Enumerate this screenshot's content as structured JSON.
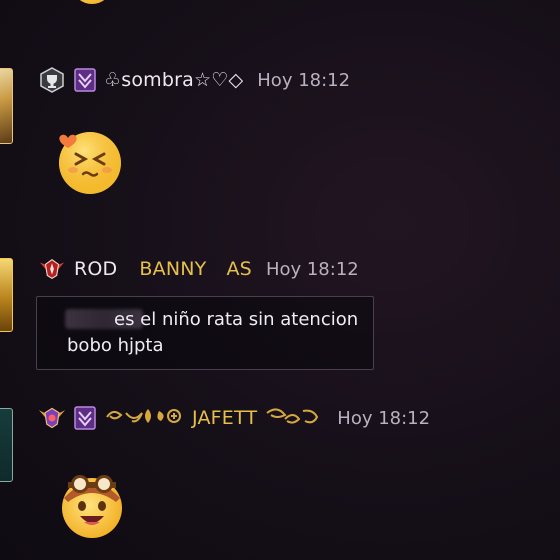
{
  "messages": [
    {
      "username": "♧sombra☆♡◇",
      "time": "Hoy 18:12",
      "sticker": "grimace-emoji-sticker",
      "rank_badge": "grey-trophy-badge",
      "role_badge": "purple-guild-badge"
    },
    {
      "username_parts": [
        "ROD",
        "BANNY",
        "AS"
      ],
      "time": "Hoy 18:12",
      "text_line1": "es el niño rata sin atencion",
      "text_line2": "bobo hjpta",
      "rank_badge": "red-winged-badge"
    },
    {
      "username": "JAFETT",
      "time": "Hoy 18:12",
      "sticker": "pilot-goggles-emoji-sticker",
      "rank_badge": "heroic-winged-badge",
      "role_badge": "purple-guild-badge"
    }
  ],
  "colors": {
    "background": "#150f18",
    "gold_name": "#e6c04b",
    "time_text": "#b9b0c0",
    "purple_badge": "#9b59c8"
  }
}
